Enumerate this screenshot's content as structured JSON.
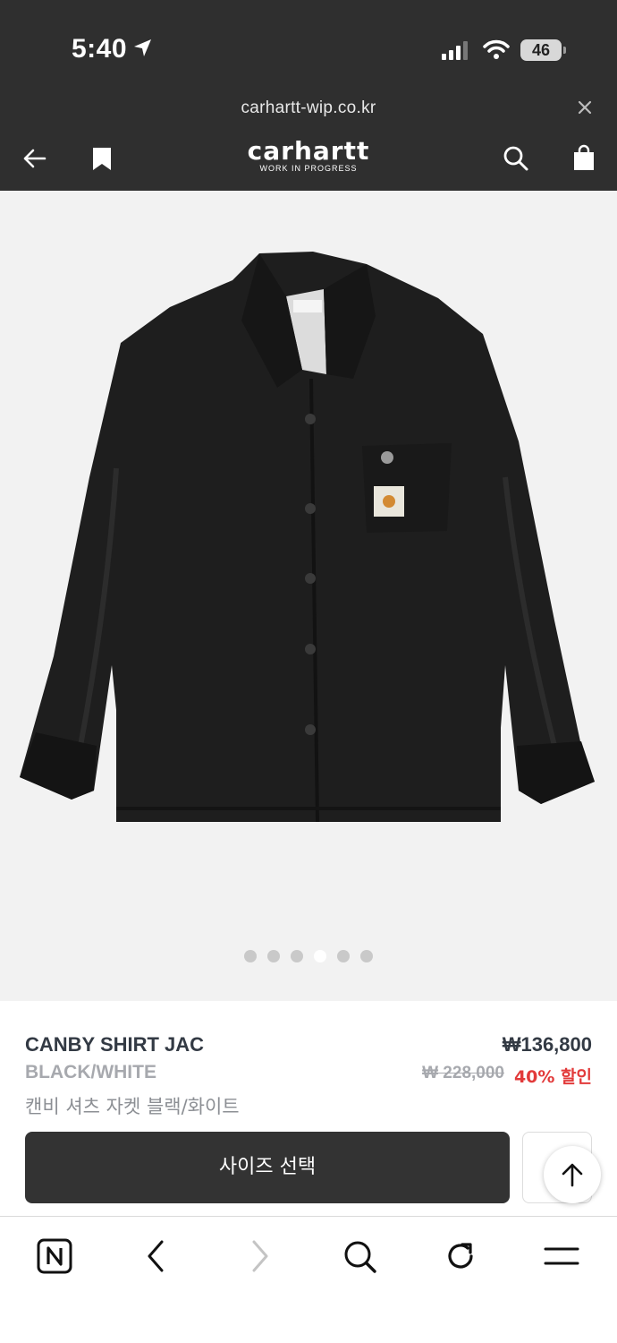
{
  "status_bar": {
    "time": "5:40",
    "battery": "46"
  },
  "browser": {
    "url": "carhartt-wip.co.kr"
  },
  "header": {
    "logo_main": "carhartt",
    "logo_sub": "WORK IN PROGRESS"
  },
  "gallery": {
    "total_images": 6,
    "active_index": 3
  },
  "product": {
    "name": "CANBY SHIRT JAC",
    "color": "BLACK/WHITE",
    "name_ko": "캔비 셔츠 자켓 블랙/화이트",
    "price": "₩136,800",
    "original_price": "₩ 228,000",
    "discount": "40% 할인"
  },
  "actions": {
    "size_select_label": "사이즈 선택"
  },
  "colors": {
    "header_bg": "#2f2f2f",
    "gallery_bg": "#f2f2f2",
    "discount_red": "#e23a3a",
    "button_dark": "#333333"
  }
}
